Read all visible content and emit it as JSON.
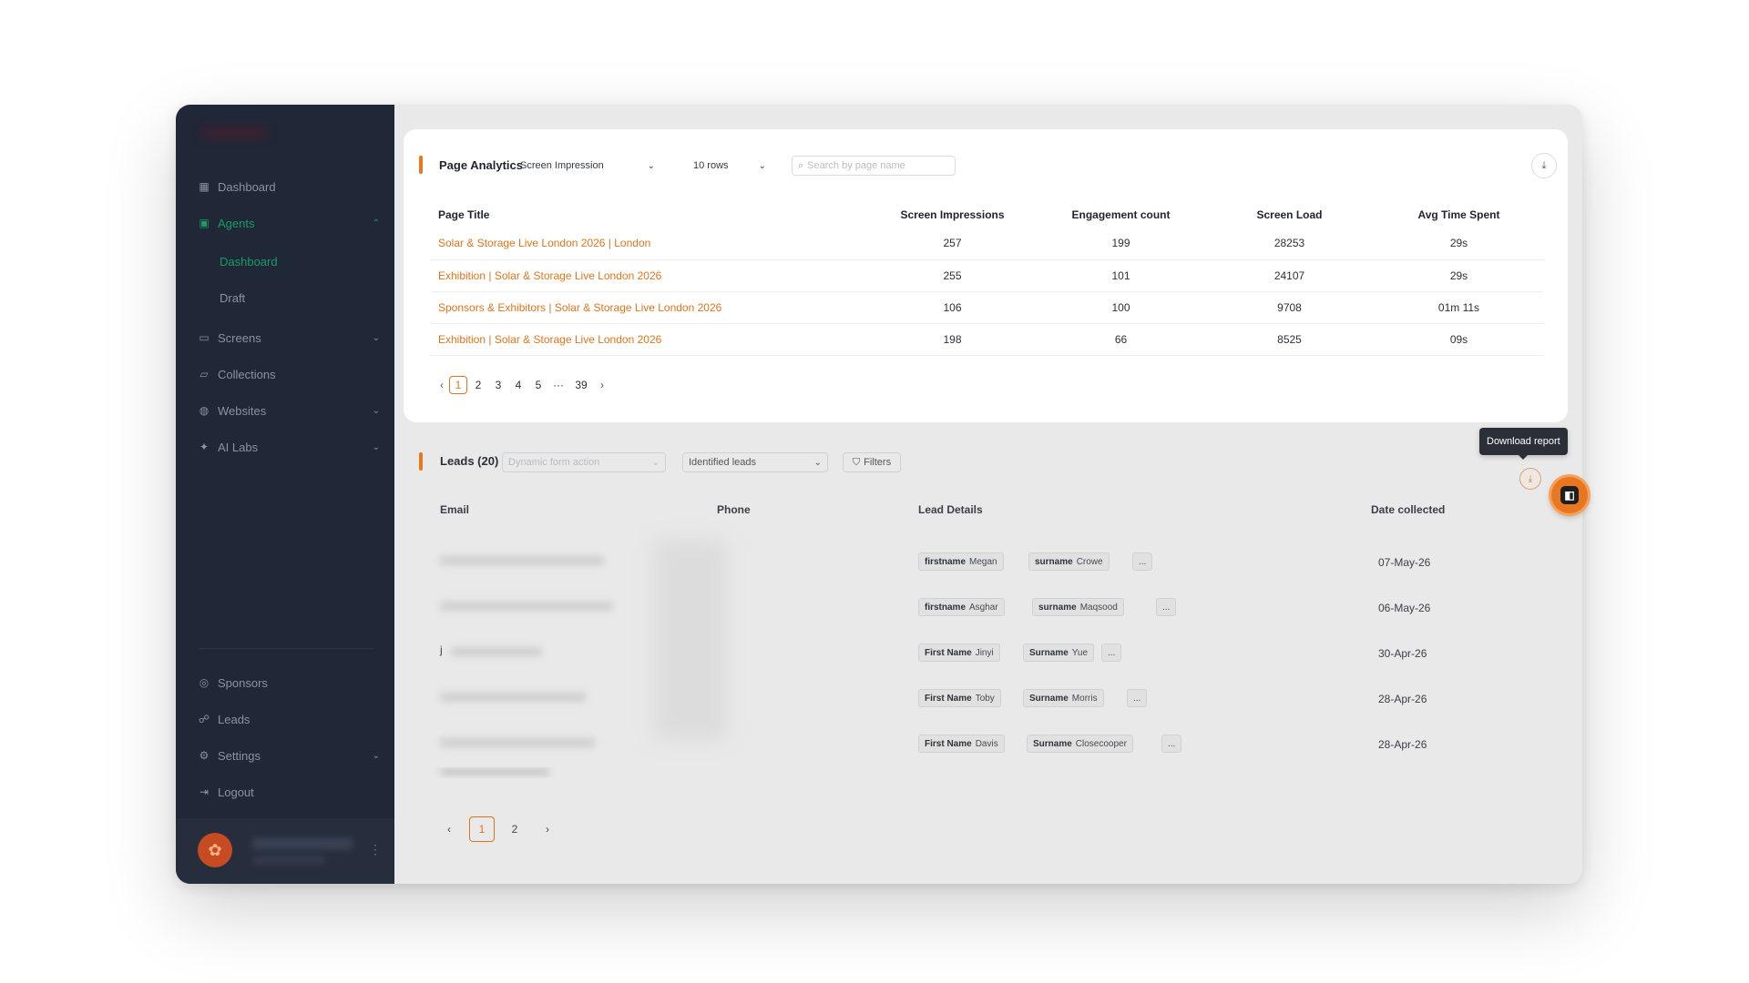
{
  "sidebar": {
    "items_top": [
      {
        "label": "Dashboard",
        "icon": "grid-icon"
      },
      {
        "label": "Agents",
        "icon": "agents-icon",
        "active": true,
        "expanded": true
      },
      {
        "label": "Screens",
        "icon": "monitor-icon"
      },
      {
        "label": "Collections",
        "icon": "folder-icon"
      },
      {
        "label": "Websites",
        "icon": "globe-icon"
      },
      {
        "label": "AI Labs",
        "icon": "sparkle-icon"
      }
    ],
    "agents_sub": [
      "Dashboard",
      "Draft"
    ],
    "items_bottom": [
      {
        "label": "Sponsors",
        "icon": "sponsor-icon"
      },
      {
        "label": "Leads",
        "icon": "users-icon"
      },
      {
        "label": "Settings",
        "icon": "gear-icon"
      },
      {
        "label": "Logout",
        "icon": "logout-icon"
      }
    ]
  },
  "analytics": {
    "title": "Page Analytics",
    "metric_select": "Screen Impression",
    "rows_select": "10 rows",
    "search_placeholder": "Search by page name",
    "columns": [
      "Page Title",
      "Screen Impressions",
      "Engagement count",
      "Screen Load",
      "Avg Time Spent"
    ],
    "rows": [
      [
        "Solar & Storage Live London 2026 | London",
        "257",
        "199",
        "28253",
        "29s"
      ],
      [
        "Exhibition | Solar & Storage Live London 2026",
        "255",
        "101",
        "24107",
        "29s"
      ],
      [
        "Sponsors & Exhibitors | Solar & Storage Live London 2026",
        "106",
        "100",
        "9708",
        "01m 11s"
      ],
      [
        "Exhibition | Solar & Storage Live London 2026",
        "198",
        "66",
        "8525",
        "09s"
      ]
    ],
    "pager": {
      "pages": [
        "1",
        "2",
        "3",
        "4",
        "5",
        "···",
        "39"
      ],
      "current": "1"
    }
  },
  "leads": {
    "title": "Leads (20)",
    "form_select_placeholder": "Dynamic form action",
    "type_select": "Identified leads",
    "filters_label": "Filters",
    "columns": [
      "Email",
      "Phone",
      "Lead Details",
      "Date collected"
    ],
    "rows": [
      {
        "email_prefix": "",
        "k1": "firstname",
        "v1": "Megan",
        "k2": "surname",
        "v2": "Crowe",
        "date": "07-May-26"
      },
      {
        "email_prefix": "",
        "k1": "firstname",
        "v1": "Asghar",
        "k2": "surname",
        "v2": "Maqsood",
        "date": "06-May-26"
      },
      {
        "email_prefix": "j",
        "k1": "First Name",
        "v1": "Jinyi",
        "k2": "Surname",
        "v2": "Yue",
        "date": "30-Apr-26"
      },
      {
        "email_prefix": "",
        "k1": "First Name",
        "v1": "Toby",
        "k2": "Surname",
        "v2": "Morris",
        "date": "28-Apr-26"
      },
      {
        "email_prefix": "",
        "k1": "First Name",
        "v1": "Davis",
        "k2": "Surname",
        "v2": "Closecooper",
        "date": "28-Apr-26"
      }
    ],
    "more_chip": "...",
    "pager": {
      "pages": [
        "1",
        "2"
      ],
      "current": "1"
    }
  },
  "tooltip": {
    "download": "Download report"
  },
  "colors": {
    "accent": "#e8771f",
    "sidebar_bg": "#202737",
    "active_green": "#1a9c63"
  }
}
